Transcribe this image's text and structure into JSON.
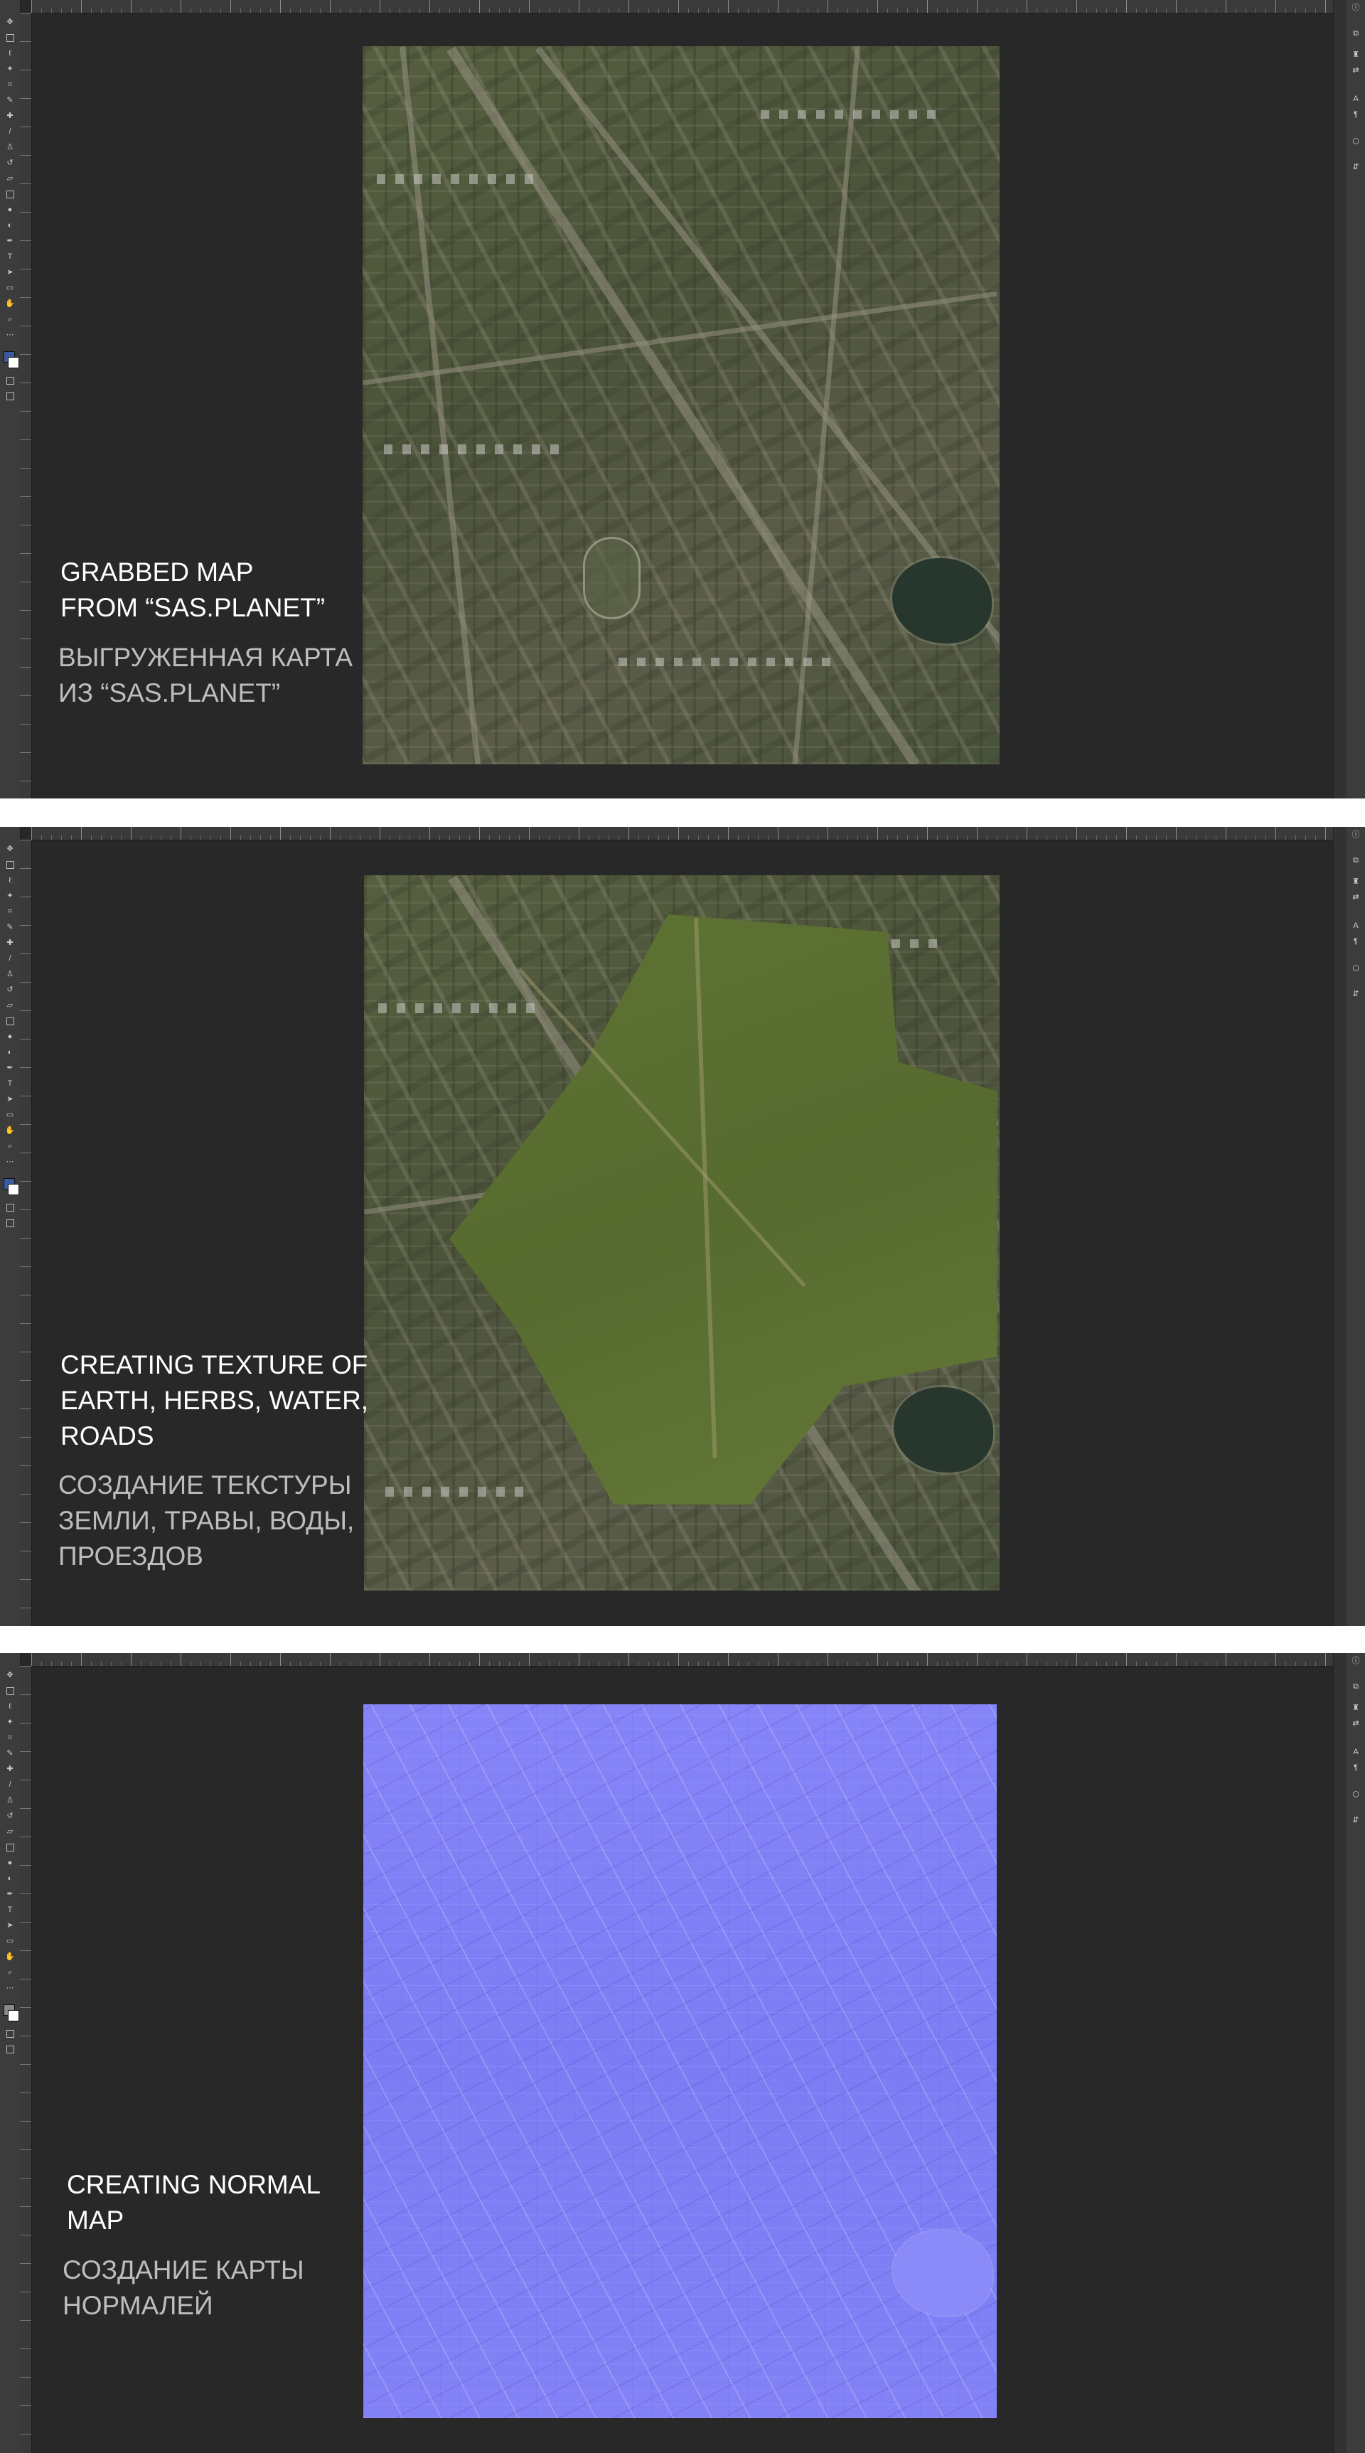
{
  "panels": [
    {
      "id": "grabbed-map",
      "caption_en": "GRABBED MAP\nFROM “SAS.PLANET”",
      "caption_ru": "ВЫГРУЖЕННАЯ КАРТА\nИЗ “SAS.PLANET”",
      "image_type": "satellite"
    },
    {
      "id": "texture",
      "caption_en": "CREATING TEXTURE OF\nEARTH, HERBS, WATER,\nROADS",
      "caption_ru": "СОЗДАНИЕ ТЕКСТУРЫ\nЗЕМЛИ, ТРАВЫ, ВОДЫ,\nПРОЕЗДОВ",
      "image_type": "satellite-textured"
    },
    {
      "id": "normal-map",
      "caption_en": "CREATING NORMAL\nMAP",
      "caption_ru": "СОЗДАНИЕ КАРТЫ\nНОРМАЛЕЙ",
      "image_type": "normal-map"
    }
  ],
  "icons": {
    "toolbar": [
      "move-icon",
      "marquee-icon",
      "lasso-icon",
      "magic-wand-icon",
      "crop-icon",
      "eyedropper-icon",
      "healing-brush-icon",
      "brush-icon",
      "clone-stamp-icon",
      "history-brush-icon",
      "eraser-icon",
      "gradient-icon",
      "blur-icon",
      "dodge-icon",
      "pen-icon",
      "type-icon",
      "path-selection-icon",
      "shape-icon",
      "hand-icon",
      "zoom-icon",
      "more-tools-icon"
    ],
    "dock": [
      "info-icon",
      "layers-icon",
      "adjustments-icon",
      "transform-icon",
      "character-icon",
      "paragraph-icon",
      "3d-icon",
      "export-icon"
    ]
  },
  "colors": {
    "workspace": "#282828",
    "panel_chrome": "#3c3c3c",
    "caption_en": "#ffffff",
    "caption_ru": "#bdbdbd",
    "normal_map": "#7f7ff7",
    "foreground_swatch": "#3b5aa0",
    "background_swatch": "#ffffff"
  }
}
